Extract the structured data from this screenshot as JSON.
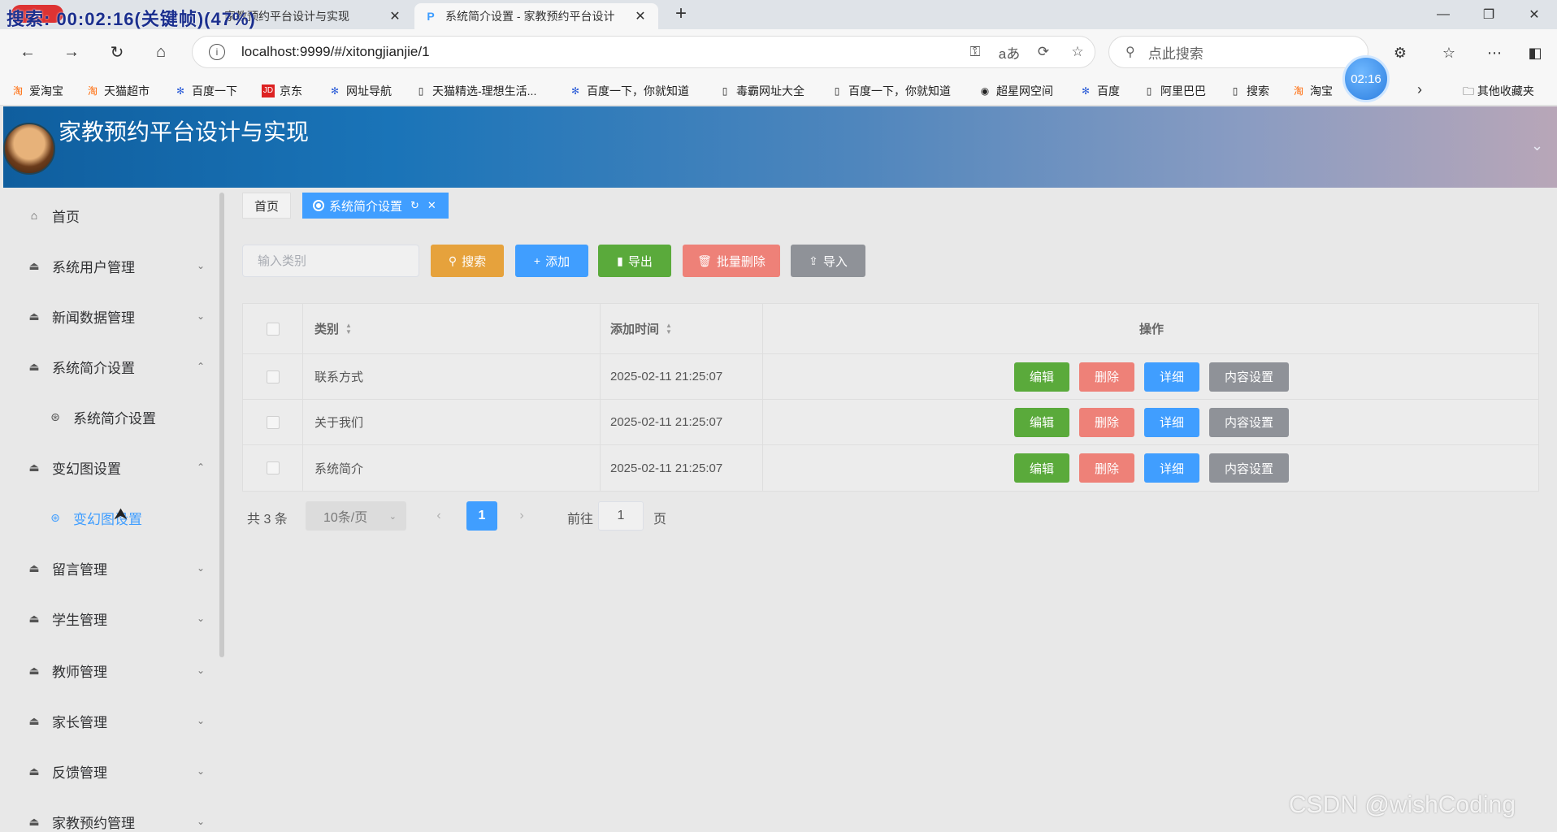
{
  "browser": {
    "overlay_text": "搜索: 00:02:16(关键帧)(47%)",
    "rec_badge": "录",
    "tabs": [
      {
        "title": "家教预约平台设计与实现",
        "active": false
      },
      {
        "title": "系统简介设置 - 家教预约平台设计",
        "active": true
      }
    ],
    "new_tab": "+",
    "window_controls": [
      "—",
      "❐",
      "✕"
    ],
    "url": "localhost:9999/#/xitongjianjie/1",
    "search_placeholder": "点此搜索",
    "clock_badge": "02:16",
    "bookmarks": [
      {
        "label": "爱淘宝",
        "icon": "taobao-icon"
      },
      {
        "label": "天猫超市",
        "icon": "taobao-icon"
      },
      {
        "label": "百度一下",
        "icon": "baidu-icon"
      },
      {
        "label": "京东",
        "icon": "jd-icon"
      },
      {
        "label": "网址导航",
        "icon": "baidu-icon"
      },
      {
        "label": "天猫精选-理想生活...",
        "icon": "page-icon"
      },
      {
        "label": "百度一下，你就知道",
        "icon": "baidu-icon"
      },
      {
        "label": "毒霸网址大全",
        "icon": "page-icon"
      },
      {
        "label": "百度一下，你就知道",
        "icon": "page-icon"
      },
      {
        "label": "超星网空间",
        "icon": "globe-icon"
      },
      {
        "label": "百度",
        "icon": "baidu-icon"
      },
      {
        "label": "阿里巴巴",
        "icon": "page-icon"
      },
      {
        "label": "搜索",
        "icon": "page-icon"
      },
      {
        "label": "淘宝",
        "icon": "taobao-icon"
      }
    ],
    "other_bookmarks": "其他收藏夹"
  },
  "header": {
    "title": "家教预约平台设计与实现"
  },
  "sidebar": {
    "items": [
      {
        "label": "首页",
        "icon": "home-icon",
        "arrow": ""
      },
      {
        "label": "系统用户管理",
        "icon": "bowl-icon",
        "arrow": "⌄"
      },
      {
        "label": "新闻数据管理",
        "icon": "bowl-icon",
        "arrow": "⌄"
      },
      {
        "label": "系统简介设置",
        "icon": "bowl-icon",
        "arrow": "⌃"
      },
      {
        "label": "系统简介设置",
        "icon": "dribbble-icon",
        "arrow": "",
        "sub": true
      },
      {
        "label": "变幻图设置",
        "icon": "bowl-icon",
        "arrow": "⌃"
      },
      {
        "label": "变幻图设置",
        "icon": "dribbble-icon",
        "arrow": "",
        "sub": true,
        "active": true
      },
      {
        "label": "留言管理",
        "icon": "bowl-icon",
        "arrow": "⌄"
      },
      {
        "label": "学生管理",
        "icon": "bowl-icon",
        "arrow": "⌄"
      },
      {
        "label": "教师管理",
        "icon": "bowl-icon",
        "arrow": "⌄"
      },
      {
        "label": "家长管理",
        "icon": "bowl-icon",
        "arrow": "⌄"
      },
      {
        "label": "反馈管理",
        "icon": "bowl-icon",
        "arrow": "⌄"
      },
      {
        "label": "家教预约管理",
        "icon": "bowl-icon",
        "arrow": "⌄"
      }
    ]
  },
  "crumbs": {
    "home": "首页",
    "active": "系统简介设置"
  },
  "toolbar": {
    "filter_placeholder": "输入类别",
    "search": "搜索",
    "add": "添加",
    "export": "导出",
    "batch_delete": "批量删除",
    "import": "导入"
  },
  "table": {
    "columns": {
      "type": "类别",
      "time": "添加时间",
      "ops": "操作"
    },
    "rows": [
      {
        "type": "联系方式",
        "time": "2025-02-11 21:25:07"
      },
      {
        "type": "关于我们",
        "time": "2025-02-11 21:25:07"
      },
      {
        "type": "系统简介",
        "time": "2025-02-11 21:25:07"
      }
    ],
    "ops": {
      "edit": "编辑",
      "delete": "删除",
      "detail": "详细",
      "content": "内容设置"
    }
  },
  "pager": {
    "total": "共 3 条",
    "page_size": "10条/页",
    "current": "1",
    "goto_label": "前往",
    "goto_value": "1",
    "unit": "页"
  },
  "watermark": "CSDN @wishCoding",
  "colors": {
    "primary": "#409eff",
    "warning": "#e6a23c",
    "success": "#5aaa3b",
    "danger": "#ee8178",
    "info": "#8f9298"
  }
}
